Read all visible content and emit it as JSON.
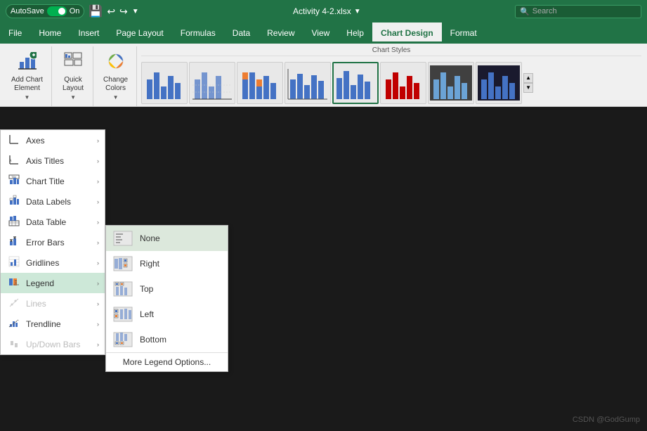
{
  "titleBar": {
    "autosave_label": "AutoSave",
    "toggle_state": "On",
    "file_name": "Activity 4-2.xlsx",
    "search_placeholder": "Search"
  },
  "menuBar": {
    "items": [
      {
        "label": "File",
        "active": false
      },
      {
        "label": "Home",
        "active": false
      },
      {
        "label": "Insert",
        "active": false
      },
      {
        "label": "Page Layout",
        "active": false
      },
      {
        "label": "Formulas",
        "active": false
      },
      {
        "label": "Data",
        "active": false
      },
      {
        "label": "Review",
        "active": false
      },
      {
        "label": "View",
        "active": false
      },
      {
        "label": "Help",
        "active": false
      },
      {
        "label": "Chart Design",
        "active": true
      },
      {
        "label": "Format",
        "active": false
      }
    ]
  },
  "ribbon": {
    "groups": [
      {
        "name": "add-chart-element",
        "label": "Add Chart\nElement",
        "sublabel": ""
      },
      {
        "name": "quick-layout",
        "label": "Quick\nLayout",
        "sublabel": ""
      },
      {
        "name": "change-colors",
        "label": "Change\nColors",
        "sublabel": ""
      }
    ],
    "chartStyles": {
      "label": "Chart Styles",
      "items": [
        1,
        2,
        3,
        4,
        5,
        6,
        7,
        8
      ]
    }
  },
  "dropdown": {
    "items": [
      {
        "id": "axes",
        "label": "Axes",
        "has_sub": true,
        "disabled": false
      },
      {
        "id": "axis-titles",
        "label": "Axis Titles",
        "has_sub": true,
        "disabled": false
      },
      {
        "id": "chart-title",
        "label": "Chart Title",
        "has_sub": true,
        "disabled": false
      },
      {
        "id": "data-labels",
        "label": "Data Labels",
        "has_sub": true,
        "disabled": false
      },
      {
        "id": "data-table",
        "label": "Data Table",
        "has_sub": true,
        "disabled": false
      },
      {
        "id": "error-bars",
        "label": "Error Bars",
        "has_sub": true,
        "disabled": false
      },
      {
        "id": "gridlines",
        "label": "Gridlines",
        "has_sub": true,
        "disabled": false
      },
      {
        "id": "legend",
        "label": "Legend",
        "has_sub": true,
        "disabled": false,
        "highlighted": true
      },
      {
        "id": "lines",
        "label": "Lines",
        "has_sub": true,
        "disabled": true
      },
      {
        "id": "trendline",
        "label": "Trendline",
        "has_sub": true,
        "disabled": false
      },
      {
        "id": "up-down-bars",
        "label": "Up/Down Bars",
        "has_sub": true,
        "disabled": true
      }
    ]
  },
  "legend_submenu": {
    "items": [
      {
        "id": "none",
        "label": "None",
        "highlighted": true
      },
      {
        "id": "right",
        "label": "Right",
        "highlighted": false
      },
      {
        "id": "top",
        "label": "Top",
        "highlighted": false
      },
      {
        "id": "left",
        "label": "Left",
        "highlighted": false
      },
      {
        "id": "bottom",
        "label": "Bottom",
        "highlighted": false
      }
    ],
    "more_label": "More Legend Options..."
  },
  "watermark": {
    "text": "CSDN @GodGump"
  }
}
